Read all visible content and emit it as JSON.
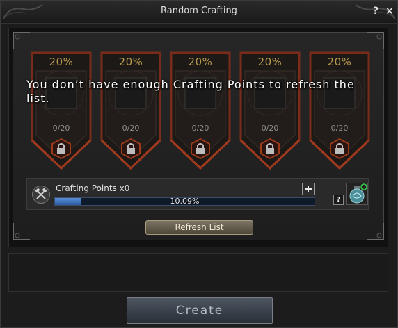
{
  "window": {
    "title": "Random Crafting",
    "help_label": "?",
    "close_label": "×"
  },
  "slots": [
    {
      "chance": "20%",
      "count": "0/20"
    },
    {
      "chance": "20%",
      "count": "0/20"
    },
    {
      "chance": "20%",
      "count": "0/20"
    },
    {
      "chance": "20%",
      "count": "0/20"
    },
    {
      "chance": "20%",
      "count": "0/20"
    }
  ],
  "message": "You don’t have enough Crafting Points to refresh the list.",
  "crafting_points": {
    "label": "Crafting Points x0",
    "progress_text": "10.09%",
    "progress": 0.1009,
    "help_label": "?"
  },
  "buttons": {
    "refresh": "Refresh List",
    "create": "Create"
  },
  "colors": {
    "accent_gold": "#b99a4e",
    "slot_border": "#7a2c1a",
    "progress_fill": "#3f72bd"
  },
  "icons": {
    "slot_lock": "lock-icon",
    "crafting": "crossed-hammers-icon",
    "add": "plus-icon",
    "potion": "potion-icon"
  }
}
